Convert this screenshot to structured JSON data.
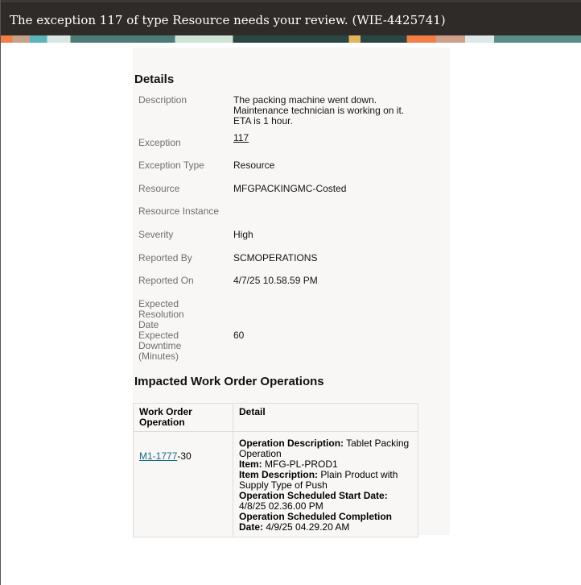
{
  "title": "The exception 117 of type Resource needs your review. (WIE-4425741)",
  "details_heading": "Details",
  "fields": [
    {
      "label": "Description",
      "value": "The packing machine went down. Maintenance technician is working on it. ETA is 1 hour."
    },
    {
      "label": "Exception",
      "value": "117"
    },
    {
      "label": "Exception Type",
      "value": "Resource"
    },
    {
      "label": "Resource",
      "value": "MFGPACKINGMC-Costed"
    },
    {
      "label": "Resource Instance",
      "value": ""
    },
    {
      "label": "Severity",
      "value": "High"
    },
    {
      "label": "Reported By",
      "value": "SCMOPERATIONS"
    },
    {
      "label": "Reported On",
      "value": "4/7/25 10.58.59 PM"
    },
    {
      "label": "Expected Resolution Date",
      "value": ""
    },
    {
      "label": "Expected Downtime (Minutes)",
      "value": "60"
    }
  ],
  "impacted_heading": "Impacted Work Order Operations",
  "table": {
    "headers": [
      "Work Order Operation",
      "Detail"
    ],
    "row": {
      "wo_link": "M1-1777",
      "wo_suffix": "-30",
      "details": [
        {
          "k": "Operation Description:",
          "v": " Tablet Packing Operation"
        },
        {
          "k": "Item:",
          "v": " MFG-PL-PROD1"
        },
        {
          "k": "Item Description:",
          "v": " Plain Product with Supply Type of Push"
        },
        {
          "k": "Operation Scheduled Start Date:",
          "v": " 4/8/25 02.36.00 PM"
        },
        {
          "k": "Operation Scheduled Completion Date:",
          "v": " 4/9/25 04.29.20 AM"
        }
      ]
    }
  }
}
